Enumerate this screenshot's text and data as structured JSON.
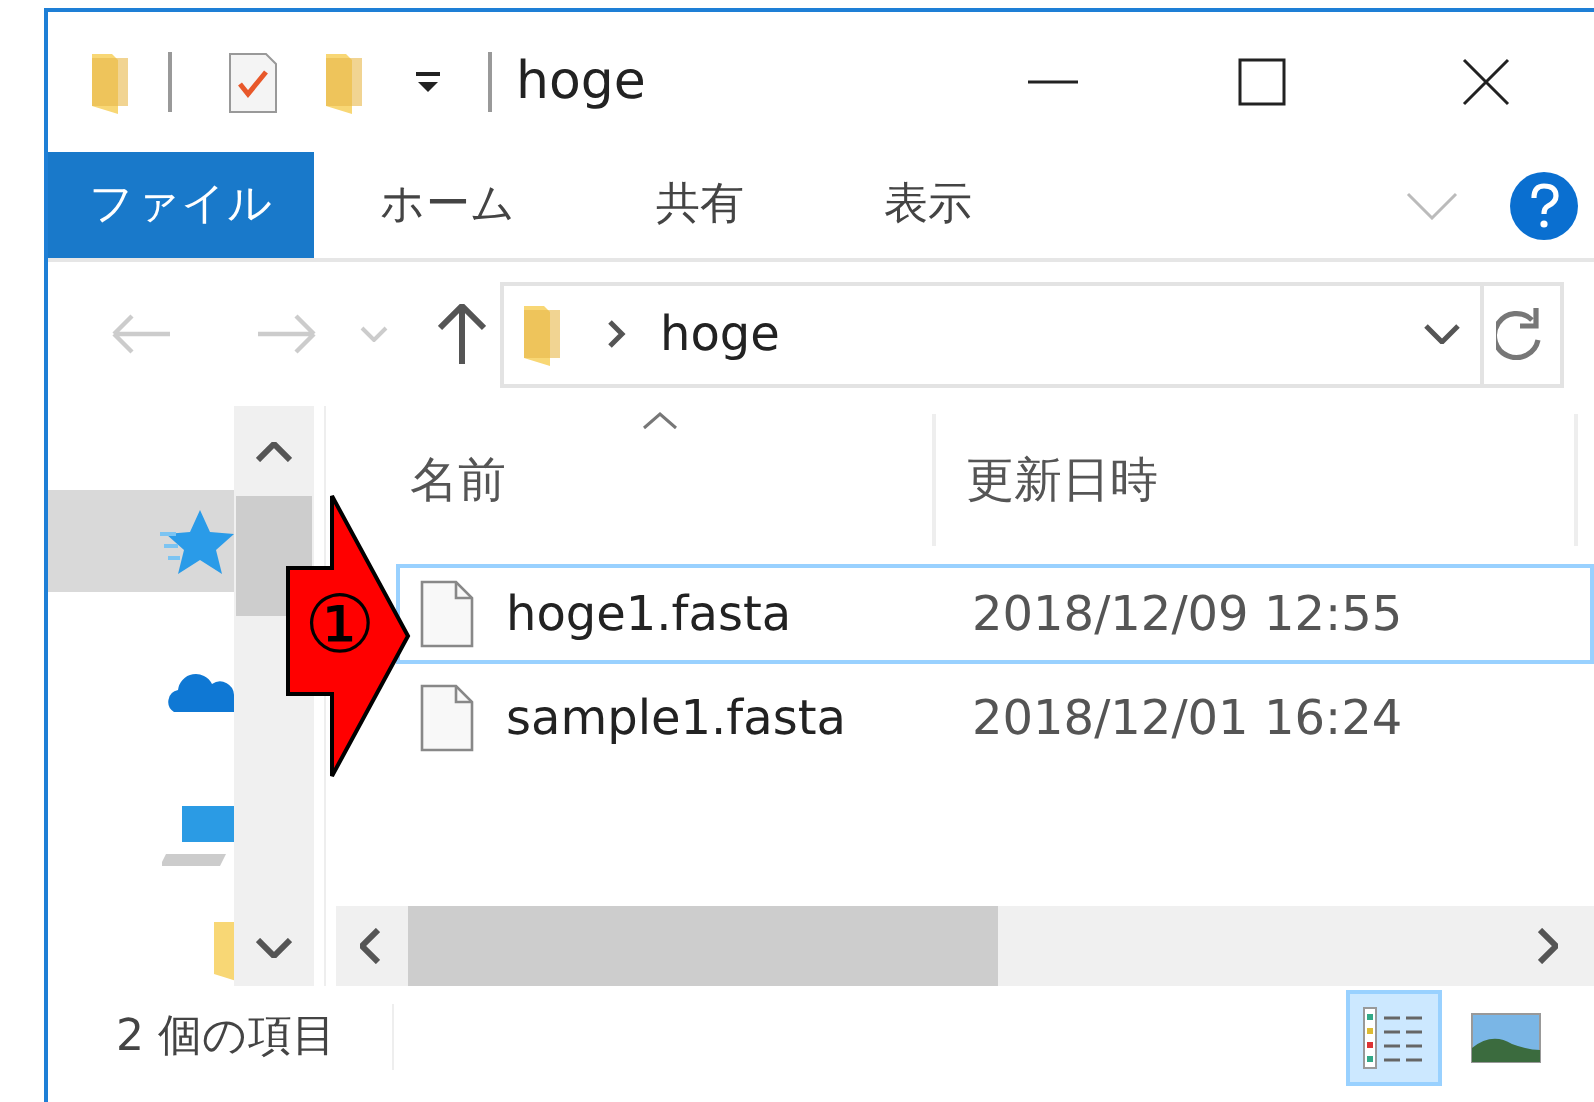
{
  "window": {
    "title": "hoge"
  },
  "ribbon_tabs": [
    {
      "label": "ファイル",
      "kind": "file"
    },
    {
      "label": "ホーム",
      "kind": "tab"
    },
    {
      "label": "共有",
      "kind": "tab"
    },
    {
      "label": "表示",
      "kind": "tab"
    }
  ],
  "address": {
    "path": "hoge"
  },
  "nav_items": [
    {
      "kind": "quick-access",
      "selected": true
    },
    {
      "kind": "cloud",
      "selected": false
    },
    {
      "kind": "pc",
      "selected": false
    },
    {
      "kind": "folder",
      "selected": false
    }
  ],
  "columns": [
    {
      "label": "名前",
      "sorted": true
    },
    {
      "label": "更新日時",
      "sorted": false
    }
  ],
  "files": [
    {
      "name": "hoge1.fasta",
      "modified": "2018/12/09 12:55",
      "selected": true
    },
    {
      "name": "sample1.fasta",
      "modified": "2018/12/01 16:24",
      "selected": false
    }
  ],
  "status_bar": {
    "text": "2 個の項目"
  },
  "view_buttons": [
    {
      "kind": "details",
      "selected": true
    },
    {
      "kind": "large-icons",
      "selected": false
    }
  ],
  "annotation": {
    "label": "①"
  }
}
